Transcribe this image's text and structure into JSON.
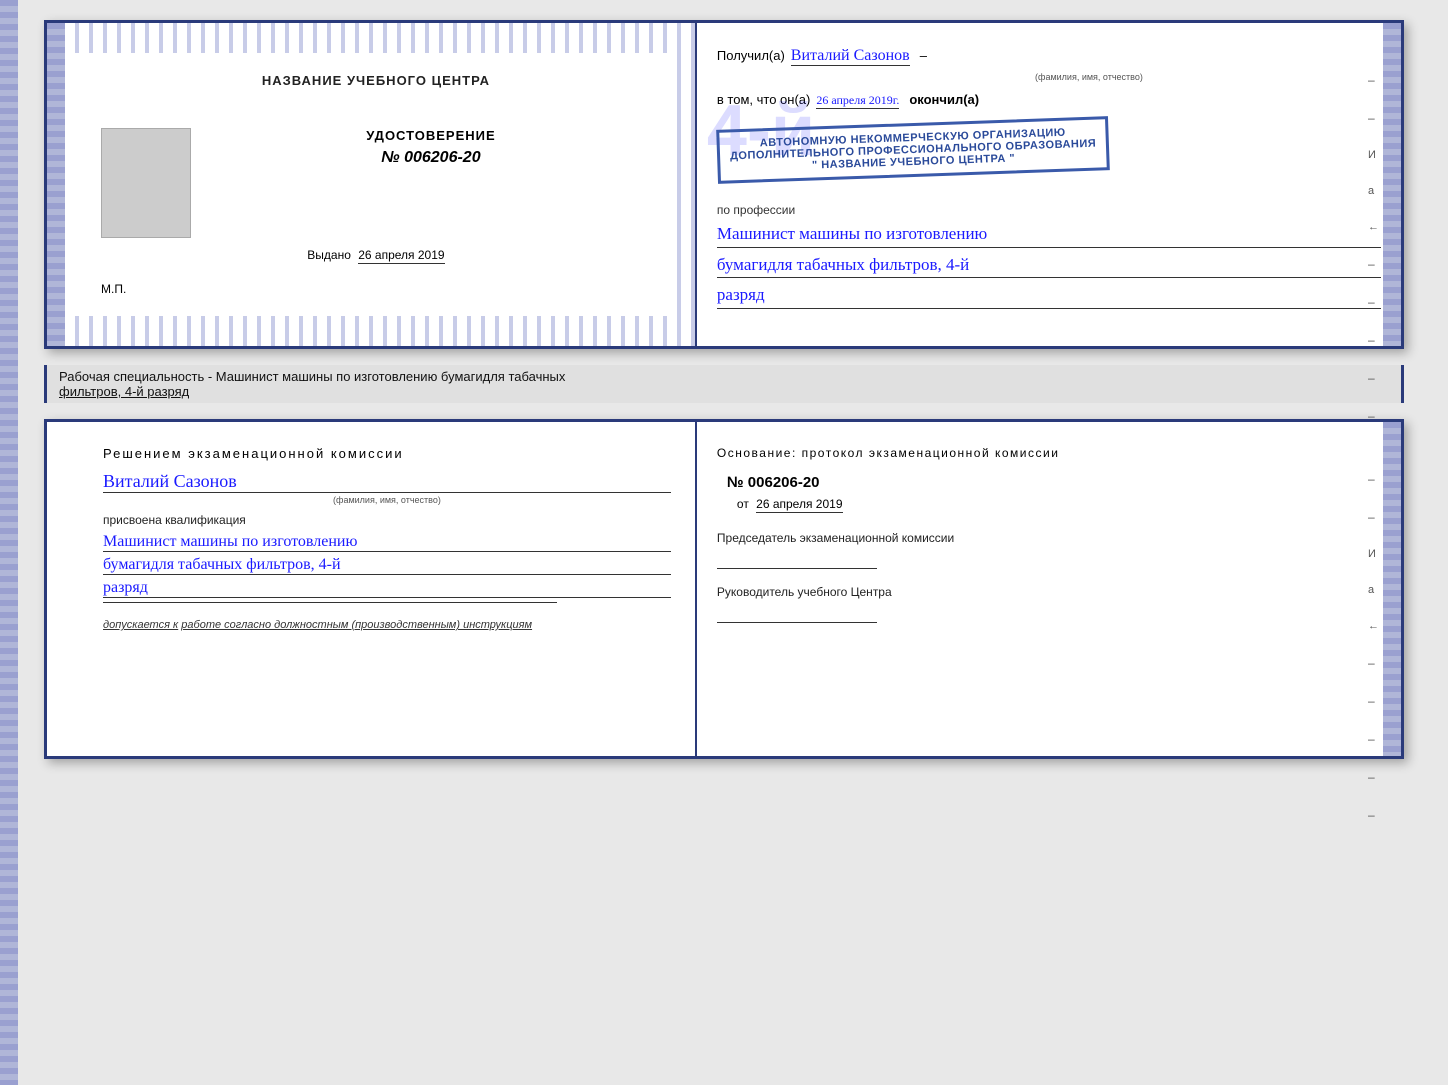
{
  "top_booklet": {
    "left": {
      "title": "НАЗВАНИЕ УЧЕБНОГО ЦЕНТРА",
      "udostoverenie_label": "УДОСТОВЕРЕНИЕ",
      "number": "№ 006206-20",
      "vydano_label": "Выдано",
      "vydano_date": "26 апреля 2019",
      "mp_label": "М.П."
    },
    "right": {
      "poluchil_prefix": "Получил(а)",
      "poluchil_name": "Виталий Сазонов",
      "fio_subtitle": "(фамилия, имя, отчество)",
      "v_tom_chto": "в том, что он(а)",
      "date_handwritten": "26 апреля 2019г.",
      "okonchil": "окончил(а)",
      "stamp_line1": "АВТОНОМНУЮ НЕКОММЕРЧЕСКУЮ ОРГАНИЗАЦИЮ",
      "stamp_line2": "ДОПОЛНИТЕЛЬНОГО ПРОФЕССИОНАЛЬНОГО ОБРАЗОВАНИЯ",
      "stamp_line3": "\" НАЗВАНИЕ УЧЕБНОГО ЦЕНТРА \"",
      "po_professii": "по профессии",
      "profession_line1": "Машинист машины по изготовлению",
      "profession_line2": "бумагидля табачных фильтров, 4-й",
      "profession_line3": "разряд"
    }
  },
  "bottom_label": {
    "text": "Рабочая специальность - Машинист машины по изготовлению бумагидля табачных",
    "text2": "фильтров, 4-й разряд"
  },
  "bottom_booklet": {
    "left": {
      "resheniem": "Решением  экзаменационной  комиссии",
      "name": "Виталий Сазонов",
      "fio_subtitle": "(фамилия, имя, отчество)",
      "prisvoena": "присвоена квалификация",
      "profession_line1": "Машинист машины по изготовлению",
      "profession_line2": "бумагидля табачных фильтров, 4-й",
      "profession_line3": "разряд",
      "dopuskaetsya": "допускается к",
      "dopuskaetsya_italic": "работе согласно должностным (производственным) инструкциям"
    },
    "right": {
      "osnovanie": "Основание: протокол экзаменационной  комиссии",
      "number": "№  006206-20",
      "ot_label": "от",
      "ot_date": "26 апреля 2019",
      "predsedatel_label": "Председатель экзаменационной комиссии",
      "rukovoditel_label": "Руководитель учебного Центра"
    }
  },
  "side_marks": {
    "И": "И",
    "а": "а",
    "dash1": "←",
    "dashes": [
      "–",
      "–",
      "–",
      "–",
      "–",
      "–",
      "–",
      "–",
      "–",
      "–"
    ]
  }
}
